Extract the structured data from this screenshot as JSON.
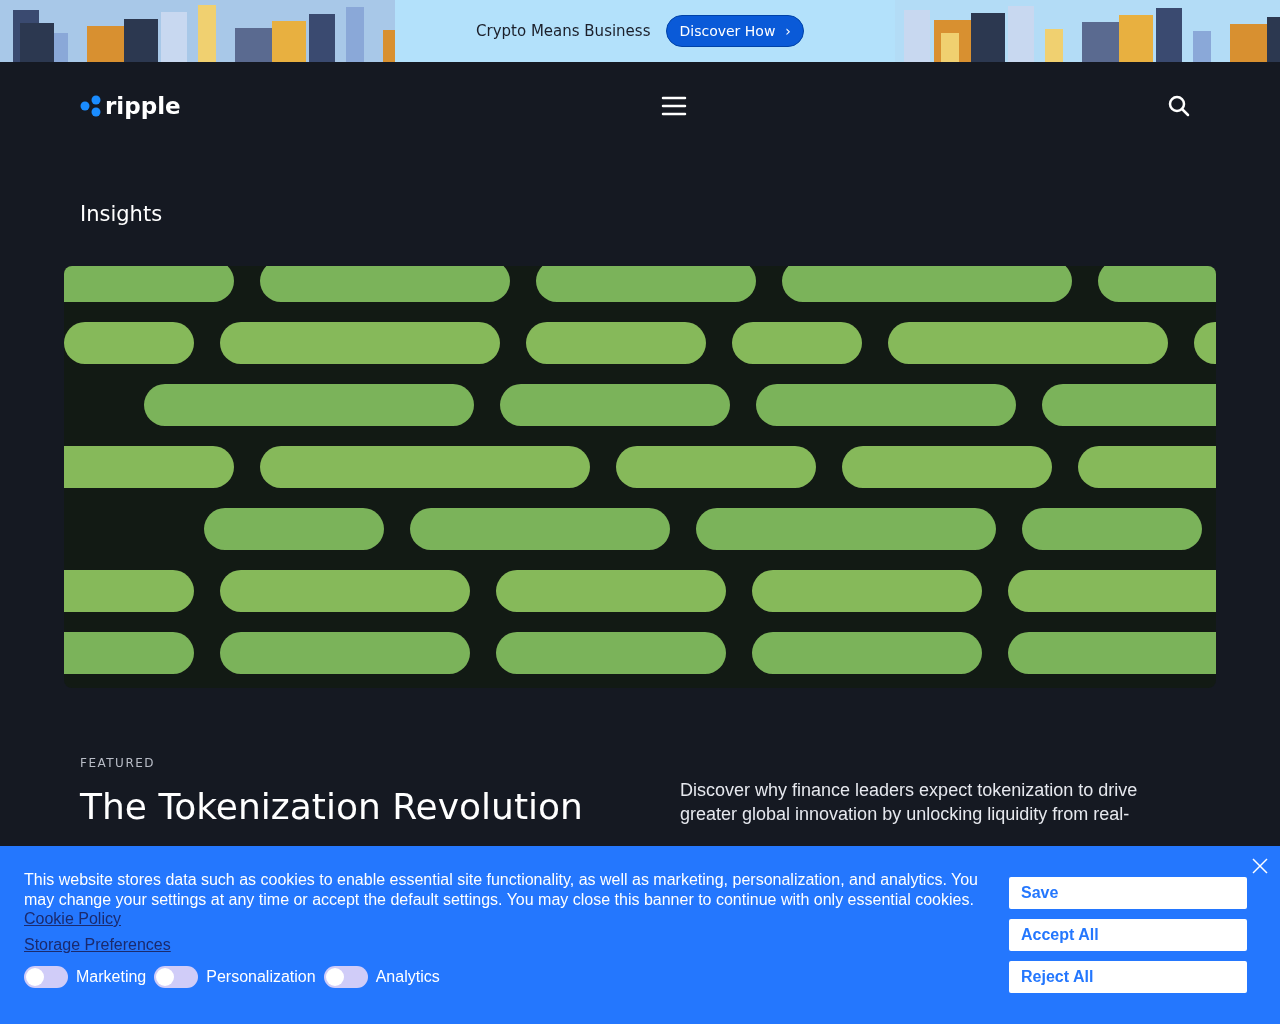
{
  "promo_bar": {
    "text": "Crypto Means Business",
    "button": "Discover How",
    "button_icon": "›"
  },
  "header": {
    "logo": "ripple"
  },
  "page_title": "Insights",
  "featured": {
    "eyebrow": "FEATURED",
    "title": "The Tokenization Revolution",
    "description": "Discover why finance leaders expect tokenization to drive greater global innovation by unlocking liquidity from real-"
  },
  "cookie_banner": {
    "message": "This website stores data such as cookies to enable essential site functionality, as well as marketing, personalization, and analytics. You may change your settings at any time or accept the default settings. You may close this banner to continue with only essential cookies.",
    "policy_link": "Cookie Policy",
    "preferences_link": "Storage Preferences",
    "toggles": [
      {
        "label": "Marketing",
        "checked": false
      },
      {
        "label": "Personalization",
        "checked": false
      },
      {
        "label": "Analytics",
        "checked": false
      }
    ],
    "buttons": [
      "Save",
      "Accept All",
      "Reject All"
    ]
  }
}
